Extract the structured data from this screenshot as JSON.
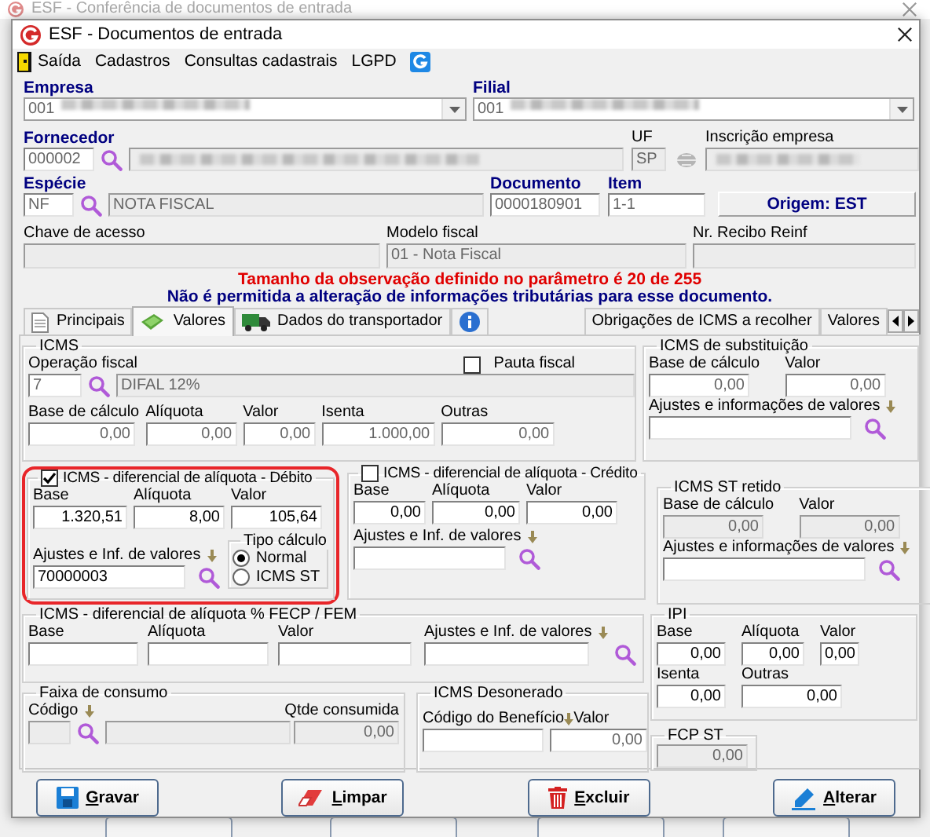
{
  "background_window": {
    "title": "ESF - Conferência de documentos de entrada"
  },
  "window": {
    "title": "ESF - Documentos de entrada"
  },
  "menu": [
    "Saída",
    "Cadastros",
    "Consultas cadastrais",
    "LGPD"
  ],
  "header": {
    "empresa": {
      "label": "Empresa",
      "value": "001",
      "redacted": true
    },
    "filial": {
      "label": "Filial",
      "value": "001",
      "redacted": true
    },
    "fornecedor": {
      "label": "Fornecedor",
      "code": {
        "value": "000002",
        "readonly": true
      },
      "name": {
        "disabled": true,
        "redacted": true
      }
    },
    "uf": {
      "label": "UF",
      "value": "SP",
      "disabled": true
    },
    "inscricao": {
      "label": "Inscrição empresa",
      "disabled": true,
      "redacted": true
    },
    "especie": {
      "label": "Espécie",
      "code": {
        "value": "NF",
        "readonly": true
      },
      "name": {
        "value": "NOTA FISCAL",
        "disabled": true
      }
    },
    "documento": {
      "label": "Documento",
      "value": "0000180901",
      "readonly": true
    },
    "item": {
      "label": "Item",
      "value": "1-1",
      "readonly": true
    },
    "origem": "Origem: EST",
    "chave": {
      "label": "Chave de acesso",
      "disabled": true
    },
    "modelo": {
      "label": "Modelo fiscal",
      "value": "01 - Nota Fiscal",
      "disabled": true
    },
    "recibo": {
      "label": "Nr. Recibo Reinf",
      "disabled": true
    }
  },
  "messages": [
    {
      "text": "Tamanho da observação definido no parâmetro é 20 de 255",
      "kind": "warning"
    },
    {
      "text": "Não é permitida a alteração de informações tributárias para esse documento.",
      "kind": "info"
    }
  ],
  "tabs": [
    {
      "label": "Principais",
      "kind": "document",
      "selected": false
    },
    {
      "label": "Valores",
      "kind": "money",
      "selected": true
    },
    {
      "label": "Dados do transportador",
      "kind": "truck",
      "selected": false
    },
    {
      "kind": "info",
      "selected": false
    },
    {
      "label": "Obrigações de ICMS a recolher",
      "kind": "text",
      "selected": false
    },
    {
      "label": "Valores",
      "kind": "text",
      "selected": false
    }
  ],
  "panel": {
    "icms": {
      "title": "ICMS",
      "operacao": {
        "label": "Operação fiscal",
        "code": {
          "value": "7",
          "readonly": true
        },
        "name": {
          "value": "DIFAL 12%",
          "disabled": true
        }
      },
      "pauta": {
        "label": "Pauta fiscal",
        "checked": false
      },
      "fields": [
        {
          "label": "Base de cálculo",
          "value": "0,00",
          "readonly": true,
          "disabled": false
        },
        {
          "label": "Alíquota",
          "value": "0,00",
          "readonly": true,
          "disabled": false
        },
        {
          "label": "Valor",
          "value": "0,00",
          "readonly": true,
          "disabled": false
        },
        {
          "label": "Isenta",
          "value": "1.000,00",
          "readonly": true,
          "disabled": false
        },
        {
          "label": "Outras",
          "value": "0,00",
          "readonly": true,
          "disabled": false
        }
      ]
    },
    "icms_st": {
      "title": "ICMS de substituição",
      "fields": [
        {
          "label": "Base de cálculo",
          "value": "0,00",
          "readonly": true,
          "disabled": false
        },
        {
          "label": "Valor",
          "value": "0,00",
          "readonly": true,
          "disabled": false
        }
      ],
      "ajustes": {
        "label": "Ajustes e informações de valores"
      }
    },
    "debito": {
      "title": "ICMS - diferencial de alíquota - Débito",
      "checked": true,
      "highlighted": true,
      "fields": [
        {
          "label": "Base",
          "value": "1.320,51",
          "readonly": false,
          "disabled": false
        },
        {
          "label": "Alíquota",
          "value": "8,00",
          "readonly": false,
          "disabled": false
        },
        {
          "label": "Valor",
          "value": "105,64",
          "readonly": false,
          "disabled": false
        }
      ],
      "ajustes": {
        "label": "Ajustes e Inf. de valores",
        "value": "70000003"
      },
      "tipo_calculo": {
        "title": "Tipo cálculo",
        "options": [
          {
            "label": "Normal",
            "selected": true
          },
          {
            "label": "ICMS ST",
            "selected": false
          }
        ]
      }
    },
    "credito": {
      "title": "ICMS - diferencial de alíquota - Crédito",
      "checked": false,
      "fields": [
        {
          "label": "Base",
          "value": "0,00",
          "readonly": false,
          "disabled": false
        },
        {
          "label": "Alíquota",
          "value": "0,00",
          "readonly": false,
          "disabled": false
        },
        {
          "label": "Valor",
          "value": "0,00",
          "readonly": false,
          "disabled": false
        }
      ],
      "ajustes": {
        "label": "Ajustes e Inf. de valores"
      }
    },
    "st_retido": {
      "title": "ICMS ST retido",
      "fields": [
        {
          "label": "Base de cálculo",
          "value": "0,00",
          "disabled": true
        },
        {
          "label": "Valor",
          "value": "0,00",
          "disabled": true
        }
      ],
      "ajustes": {
        "label": "Ajustes e informações de valores"
      }
    },
    "fecp": {
      "title": "ICMS - diferencial de alíquota % FECP / FEM",
      "fields": [
        {
          "label": "Base",
          "disabled": false
        },
        {
          "label": "Alíquota",
          "disabled": false
        },
        {
          "label": "Valor",
          "disabled": false
        }
      ],
      "ajustes": {
        "label": "Ajustes e Inf. de valores"
      }
    },
    "faixa": {
      "title": "Faixa de consumo",
      "codigo": {
        "label": "Código",
        "disabled": true
      },
      "name": {
        "disabled": true
      },
      "qtde": {
        "label": "Qtde consumida",
        "value": "0,00",
        "disabled": true
      }
    },
    "desonerado": {
      "title": "ICMS Desonerado",
      "fields": [
        {
          "label": "Código do Benefício",
          "disabled": false
        },
        {
          "label": "Valor",
          "value": "0,00",
          "readonly": true,
          "disabled": false
        }
      ]
    },
    "ipi": {
      "title": "IPI",
      "fields": [
        {
          "label": "Base",
          "value": "0,00",
          "readonly": false,
          "disabled": false
        },
        {
          "label": "Alíquota",
          "value": "0,00",
          "readonly": false,
          "disabled": false
        },
        {
          "label": "Valor",
          "value": "0,00",
          "readonly": false,
          "disabled": false
        },
        {
          "label": "Isenta",
          "value": "0,00",
          "readonly": false,
          "disabled": false
        },
        {
          "label": "Outras",
          "value": "0,00",
          "readonly": false,
          "disabled": false
        }
      ]
    },
    "fcp_st": {
      "title": "FCP ST",
      "value": "0,00",
      "disabled": true
    }
  },
  "buttons": [
    {
      "label": "Gravar",
      "kind": "save"
    },
    {
      "label": "Limpar",
      "kind": "eraser"
    },
    {
      "label": "Excluir",
      "kind": "trash"
    },
    {
      "label": "Alterar",
      "kind": "pencil"
    }
  ]
}
